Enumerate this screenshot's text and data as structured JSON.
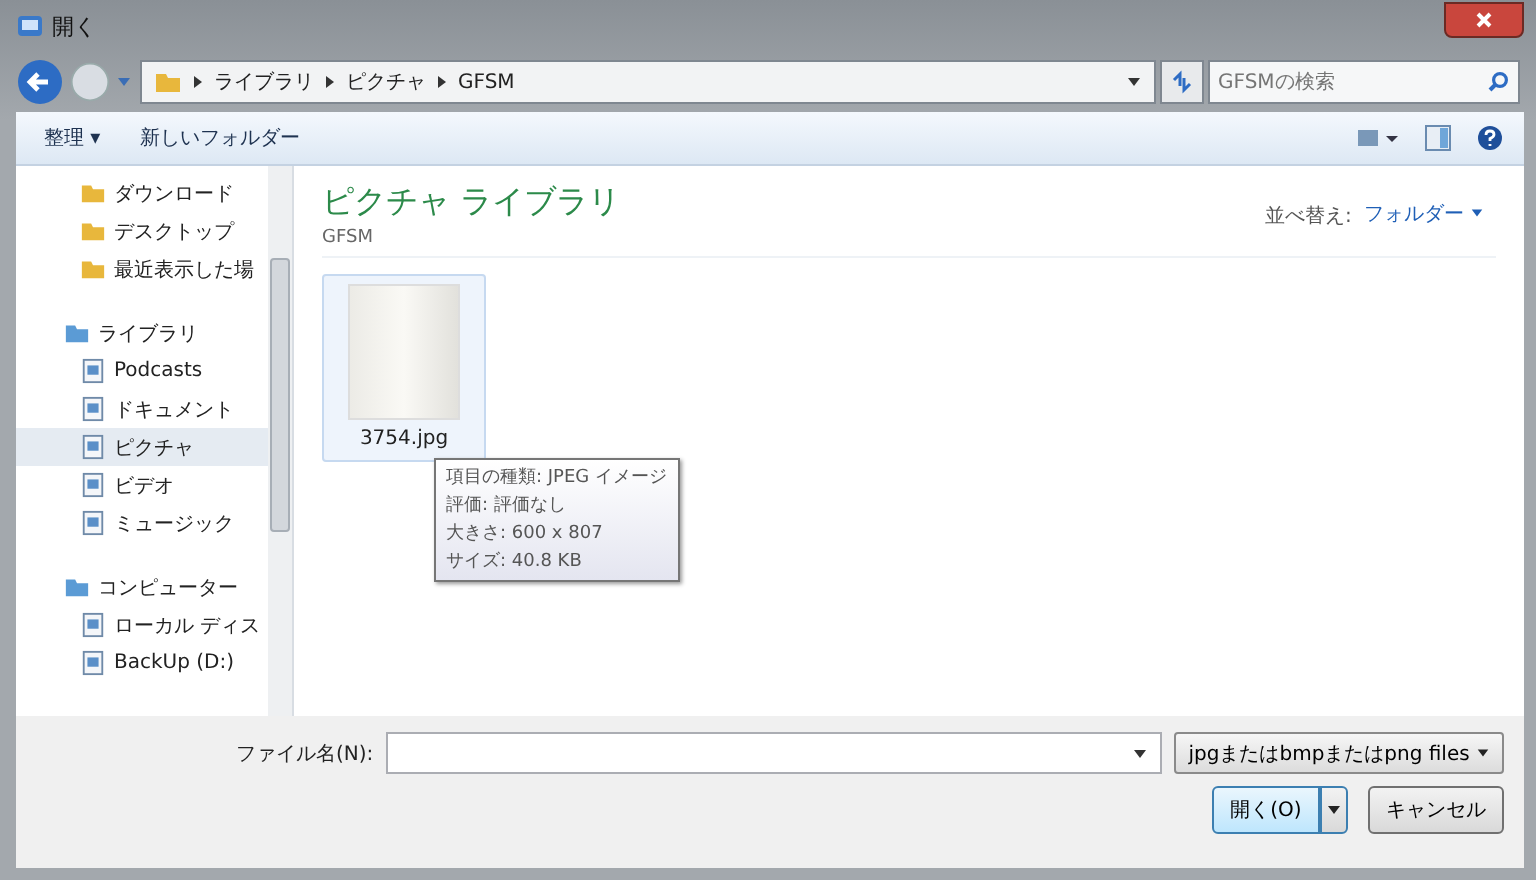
{
  "window": {
    "title": "開く"
  },
  "address": {
    "crumbs": [
      "ライブラリ",
      "ピクチャ",
      "GFSM"
    ],
    "search_placeholder": "GFSMの検索"
  },
  "toolbar": {
    "organize": "整理 ▾",
    "new_folder": "新しいフォルダー"
  },
  "sidebar": {
    "items": [
      {
        "label": "ダウンロード",
        "selected": false
      },
      {
        "label": "デスクトップ",
        "selected": false
      },
      {
        "label": "最近表示した場",
        "selected": false
      },
      {
        "label": "ライブラリ",
        "selected": false,
        "children": [
          {
            "label": "Podcasts",
            "selected": false
          },
          {
            "label": "ドキュメント",
            "selected": false
          },
          {
            "label": "ピクチャ",
            "selected": true
          },
          {
            "label": "ビデオ",
            "selected": false
          },
          {
            "label": "ミュージック",
            "selected": false
          }
        ]
      },
      {
        "label": "コンピューター",
        "selected": false,
        "children": [
          {
            "label": "ローカル ディス",
            "selected": false
          },
          {
            "label": "BackUp (D:)",
            "selected": false
          }
        ]
      }
    ]
  },
  "content": {
    "title": "ピクチャ ライブラリ",
    "subtitle": "GFSM",
    "sort_label": "並べ替え:",
    "sort_value": "フォルダー",
    "files": [
      {
        "name": "3754.jpg",
        "selected": true
      }
    ],
    "tooltip": [
      "項目の種類: JPEG イメージ",
      "評価: 評価なし",
      "大きさ: 600 x 807",
      "サイズ: 40.8 KB"
    ]
  },
  "footer": {
    "filename_label": "ファイル名(N):",
    "filetype": "jpgまたはbmpまたはpng files",
    "open_button": "開く(O)",
    "cancel_button": "キャンセル"
  }
}
